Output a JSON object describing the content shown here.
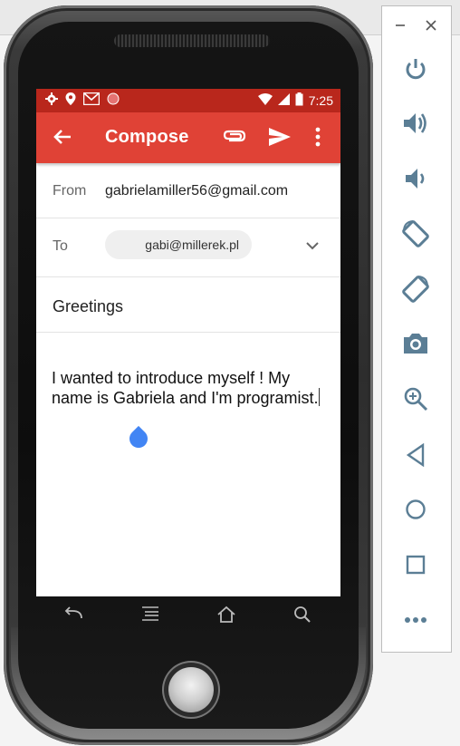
{
  "status_bar": {
    "time": "7:25"
  },
  "app_bar": {
    "title": "Compose"
  },
  "compose": {
    "from_label": "From",
    "from_value": "gabrielamiller56@gmail.com",
    "to_label": "To",
    "to_chip": "gabi@millerek.pl",
    "subject": "Greetings",
    "body": "I wanted to introduce myself ! My name is Gabriela and I'm programist."
  },
  "emulator_panel": {
    "controls": [
      "power-icon",
      "volume-up-icon",
      "volume-down-icon",
      "rotate-left-icon",
      "rotate-right-icon",
      "camera-icon",
      "zoom-icon",
      "back-icon",
      "home-icon",
      "overview-icon",
      "more-icon"
    ]
  },
  "colors": {
    "status_bar": "#b9271c",
    "app_bar": "#e04236",
    "accent_blue": "#4285f4",
    "panel_icon": "#5b7e95"
  }
}
